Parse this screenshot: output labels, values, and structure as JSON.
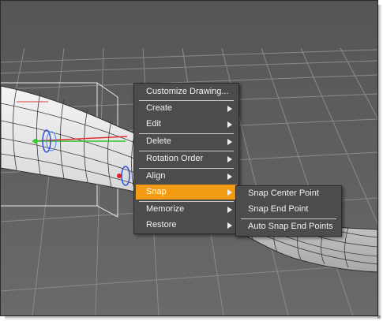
{
  "context_menu": {
    "items": [
      {
        "label": "Customize Drawing..."
      },
      {
        "label": "Create"
      },
      {
        "label": "Edit"
      },
      {
        "label": "Delete"
      },
      {
        "label": "Rotation Order"
      },
      {
        "label": "Align"
      },
      {
        "label": "Snap"
      },
      {
        "label": "Memorize"
      },
      {
        "label": "Restore"
      }
    ]
  },
  "snap_submenu": {
    "items": [
      {
        "label": "Snap Center Point"
      },
      {
        "label": "Snap End Point"
      },
      {
        "label": "Auto Snap End Points"
      }
    ]
  },
  "colors": {
    "viewport_background": "#5f5f5f",
    "menu_background": "#4c4c4c",
    "menu_highlight": "#f39c12",
    "grid_line": "#8a8a8a"
  }
}
